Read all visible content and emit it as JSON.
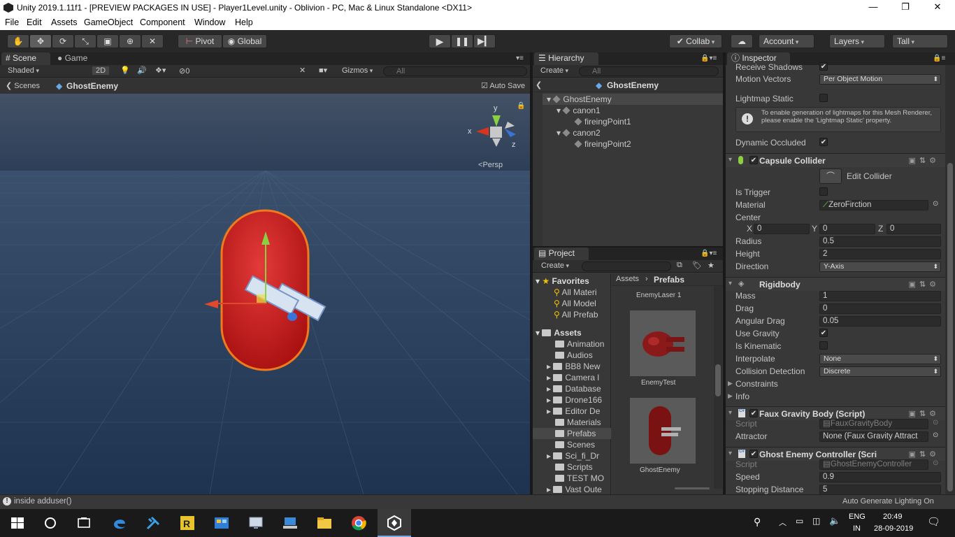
{
  "window": {
    "title": "Unity 2019.1.11f1 - [PREVIEW PACKAGES IN USE] - Player1Level.unity - Oblivion - PC, Mac & Linux Standalone <DX11>"
  },
  "menu": [
    "File",
    "Edit",
    "Assets",
    "GameObject",
    "Component",
    "Window",
    "Help"
  ],
  "toolbar": {
    "pivot": "Pivot",
    "global": "Global",
    "collab": "Collab",
    "account": "Account",
    "layers": "Layers",
    "layout": "Tall"
  },
  "scene": {
    "tab_scene": "Scene",
    "tab_game": "Game",
    "shading": "Shaded",
    "twod": "2D",
    "fx_count": "0",
    "gizmos": "Gizmos",
    "search_placeholder": "All",
    "breadcrumb_root": "Scenes",
    "breadcrumb_item": "GhostEnemy",
    "auto_save": "Auto Save",
    "persp": "Persp",
    "axis_y": "y",
    "axis_x": "x",
    "axis_z": "z"
  },
  "hierarchy": {
    "tab": "Hierarchy",
    "create": "Create",
    "search_placeholder": "All",
    "header": "GhostEnemy",
    "items": [
      {
        "label": "GhostEnemy"
      },
      {
        "label": "canon1"
      },
      {
        "label": "fireingPoint1"
      },
      {
        "label": "canon2"
      },
      {
        "label": "fireingPoint2"
      }
    ]
  },
  "project": {
    "tab": "Project",
    "create": "Create",
    "favorites": "Favorites",
    "fav_items": [
      "All Materi",
      "All Model",
      "All Prefab"
    ],
    "assets": "Assets",
    "folders": [
      "Animation",
      "Audios",
      "BB8 New",
      "Camera l",
      "Database",
      "Drone166",
      "Editor De",
      "Materials",
      "Prefabs",
      "Scenes",
      "Sci_fi_Dr",
      "Scripts",
      "TEST MO",
      "Vast Oute"
    ],
    "breadcrumb": [
      "Assets",
      "Prefabs"
    ],
    "prefabs": [
      "EnemyLaser 1",
      "EnemyTest",
      "GhostEnemy"
    ]
  },
  "inspector": {
    "tab": "Inspector",
    "receive_shadows": "Receive Shadows",
    "motion_vectors": {
      "label": "Motion Vectors",
      "value": "Per Object Motion"
    },
    "lightmap_static": "Lightmap Static",
    "help_text": "To enable generation of lightmaps for this Mesh Renderer, please enable the 'Lightmap Static' property.",
    "dynamic_occluded": "Dynamic Occluded",
    "capsule": {
      "title": "Capsule Collider",
      "edit_collider": "Edit Collider",
      "is_trigger": "Is Trigger",
      "material": {
        "label": "Material",
        "value": "ZeroFirction"
      },
      "center": {
        "label": "Center",
        "x_label": "X",
        "y_label": "Y",
        "z_label": "Z",
        "x": "0",
        "y": "0",
        "z": "0"
      },
      "radius": {
        "label": "Radius",
        "value": "0.5"
      },
      "height": {
        "label": "Height",
        "value": "2"
      },
      "direction": {
        "label": "Direction",
        "value": "Y-Axis"
      }
    },
    "rigidbody": {
      "title": "Rigidbody",
      "mass": {
        "label": "Mass",
        "value": "1"
      },
      "drag": {
        "label": "Drag",
        "value": "0"
      },
      "angular_drag": {
        "label": "Angular Drag",
        "value": "0.05"
      },
      "use_gravity": "Use Gravity",
      "is_kinematic": "Is Kinematic",
      "interpolate": {
        "label": "Interpolate",
        "value": "None"
      },
      "collision": {
        "label": "Collision Detection",
        "value": "Discrete"
      },
      "constraints": "Constraints",
      "info": "Info"
    },
    "faux": {
      "title": "Faux Gravity Body (Script)",
      "script": {
        "label": "Script",
        "value": "FauxGravityBody"
      },
      "attractor": {
        "label": "Attractor",
        "value": "None (Faux Gravity Attract"
      }
    },
    "ghost": {
      "title": "Ghost Enemy Controller (Scri",
      "script": {
        "label": "Script",
        "value": "GhostEnemyController"
      },
      "speed": {
        "label": "Speed",
        "value": "0.9"
      },
      "stopping": {
        "label": "Stopping Distance",
        "value": "5"
      }
    }
  },
  "status": {
    "message": "inside adduser()",
    "right": "Auto Generate Lighting On"
  },
  "taskbar": {
    "lang1": "ENG",
    "lang2": "IN",
    "time": "20:49",
    "date": "28-09-2019"
  }
}
